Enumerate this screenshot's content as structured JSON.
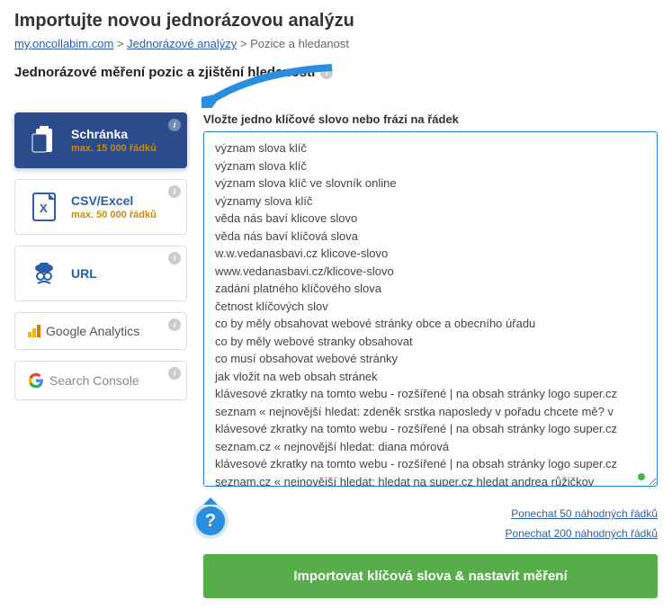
{
  "page": {
    "title": "Importujte novou jednorázovou analýzu"
  },
  "breadcrumb": {
    "root": "my.oncollabim.com",
    "level1": "Jednorázové analýzy",
    "level2": "Pozice a hledanost"
  },
  "section": {
    "title": "Jednorázové měření pozic a zjištění hledanosti"
  },
  "sources": {
    "clipboard": {
      "label": "Schránka",
      "sub": "max. 15 000 řádků"
    },
    "csv": {
      "label": "CSV/Excel",
      "sub": "max. 50 000 řádků"
    },
    "url": {
      "label": "URL"
    },
    "ga": {
      "label": "Google Analytics"
    },
    "sc": {
      "label": "Search Console"
    }
  },
  "main": {
    "field_label": "Vložte jedno klíčové slovo nebo frázi na řádek",
    "textarea_value": "význam slova klíč\nvýznam slova klíč\nvýznam slova klíč ve slovník online\nvýznamy slova klíč\nvěda nás baví klicove slovo\nvěda nás baví klíčová slova\nw.w.vedanasbavi.cz klicove-slovo\nwww.vedanasbavi.cz/klicove-slovo\nzadání platného klíčového slova\nčetnost klíčových slov\nco by měly obsahovat webové stránky obce a obecního úřadu\nco by měly webové stranky obsahovat\nco musí obsahovat webové stránky\njak vložit na web obsah stránek\nklávesové zkratky na tomto webu - rozšířené | na obsah stránky logo super.cz seznam « nejnovější hledat: zdeněk srstka naposledy v pořadu chcete mě? v\nklávesové zkratky na tomto webu - rozšířené | na obsah stránky logo super.cz seznam.cz « nejnovější hledat: diana mórová\nklávesové zkratky na tomto webu - rozšířené | na obsah stránky logo super.cz seznam.cz « nejnovější hledat: hledat na super.cz hledat andrea růžičkov\nklávesové zkratky na tomto webu - rozšířené | na obsah stránky logo super.cz seznam.cz «"
  },
  "links": {
    "keep50": "Ponechat 50 náhodných řádků",
    "keep200": "Ponechat 200 náhodných řádků"
  },
  "button": {
    "import": "Importovat klíčová slova & nastavit měření"
  },
  "help": {
    "symbol": "?"
  }
}
